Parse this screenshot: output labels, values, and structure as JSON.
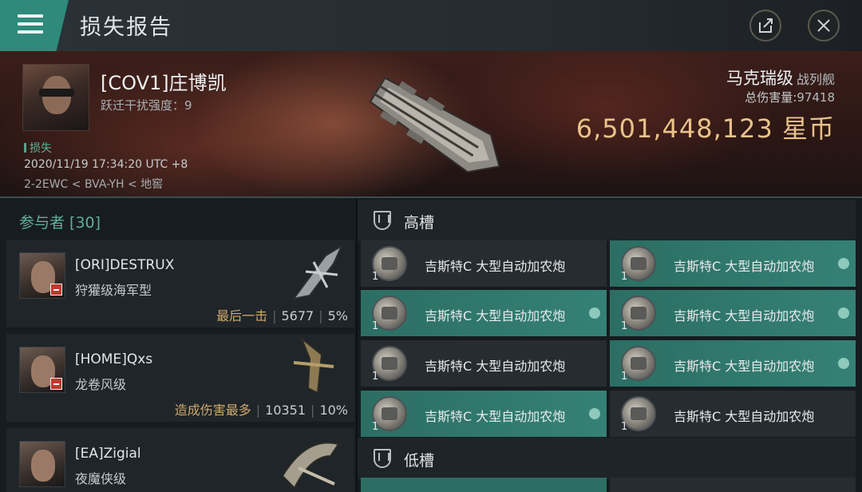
{
  "header": {
    "title": "损失报告"
  },
  "victim": {
    "name": "[COV1]庄博凯",
    "warp_disruption": "跃迁干扰强度：9",
    "status": "损失",
    "time": "2020/11/19 17:34:20 UTC +8",
    "location": "2-2EWC < BVA-YH < 地窖",
    "ship_name": "马克瑞级",
    "ship_class": "战列舰",
    "total_damage_label": "总伤害量:",
    "total_damage_value": "97418",
    "isk_value": "6,501,448,123 星币"
  },
  "participants": {
    "title": "参与者 [30]",
    "items": [
      {
        "name": "[ORI]DESTRUX",
        "ship": "狩獾级海军型",
        "tag": "最后一击",
        "damage": "5677",
        "percent": "5%"
      },
      {
        "name": "[HOME]Qxs",
        "ship": "龙卷风级",
        "tag": "造成伤害最多",
        "damage": "10351",
        "percent": "10%"
      },
      {
        "name": "[EA]Zigial",
        "ship": "夜魔侠级"
      }
    ]
  },
  "fitting": {
    "high_slot_label": "高槽",
    "low_slot_label": "低槽",
    "modules": [
      {
        "name": "吉斯特C 大型自动加农炮",
        "qty": "1",
        "highlighted": false
      },
      {
        "name": "吉斯特C 大型自动加农炮",
        "qty": "1",
        "highlighted": true
      },
      {
        "name": "吉斯特C 大型自动加农炮",
        "qty": "1",
        "highlighted": true
      },
      {
        "name": "吉斯特C 大型自动加农炮",
        "qty": "1",
        "highlighted": true
      },
      {
        "name": "吉斯特C 大型自动加农炮",
        "qty": "1",
        "highlighted": false
      },
      {
        "name": "吉斯特C 大型自动加农炮",
        "qty": "1",
        "highlighted": true
      },
      {
        "name": "吉斯特C 大型自动加农炮",
        "qty": "1",
        "highlighted": true
      },
      {
        "name": "吉斯特C 大型自动加农炮",
        "qty": "1",
        "highlighted": false
      }
    ]
  },
  "colors": {
    "accent": "#2f8a7b",
    "isk": "#e8c28a",
    "highlight": "#358175"
  }
}
